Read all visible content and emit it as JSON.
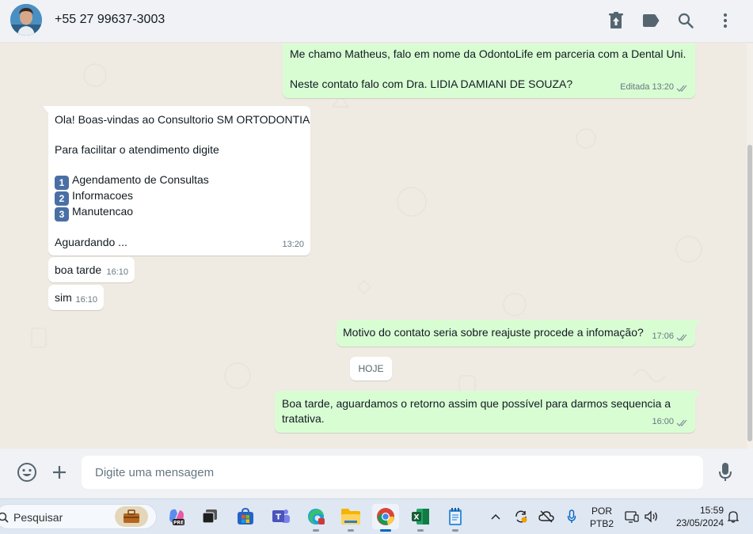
{
  "header": {
    "contact_name": "+55 27 99637-3003",
    "icons": [
      "sticker-pack-icon",
      "label-icon",
      "search-icon",
      "menu-icon"
    ]
  },
  "messages": [
    {
      "direction": "out",
      "lines": [
        "Me chamo Matheus, falo em nome da OdontoLife em parceria com a Dental Uni.",
        "",
        "Neste contato falo com Dra. LIDIA DAMIANI DE SOUZA?"
      ],
      "edited_label": "Editada",
      "time": "13:20",
      "status": "read"
    },
    {
      "direction": "in",
      "lines": [
        "Ola! Boas-vindas ao Consultorio SM ORTODONTIA",
        "",
        "Para facilitar o atendimento digite",
        ""
      ],
      "options": [
        {
          "number": "1",
          "label": "Agendamento de Consultas"
        },
        {
          "number": "2",
          "label": "Informacoes"
        },
        {
          "number": "3",
          "label": "Manutencao"
        }
      ],
      "footer": "Aguardando ...",
      "time": "13:20"
    },
    {
      "direction": "in",
      "text": "boa tarde",
      "time": "16:10"
    },
    {
      "direction": "in",
      "text": "sim",
      "time": "16:10"
    },
    {
      "direction": "out",
      "text": "Motivo do contato seria sobre reajuste procede a infomação?",
      "time": "17:06",
      "status": "read"
    },
    {
      "direction": "out",
      "lines": [
        "Boa tarde, aguardamos o retorno assim que possível para darmos sequencia a",
        "tratativa."
      ],
      "time": "16:00",
      "status": "read"
    }
  ],
  "day_separator": "HOJE",
  "composer": {
    "placeholder": "Digite uma mensagem",
    "icons": [
      "emoji-icon",
      "attach-plus-icon",
      "microphone-icon"
    ]
  },
  "taskbar": {
    "search_label": "Pesquisar",
    "apps": [
      "briefcase-app",
      "copilot-pre-app",
      "task-view-app",
      "store-app",
      "teams-app",
      "edge-app",
      "file-explorer-app",
      "chrome-app",
      "excel-app",
      "notepad-app"
    ],
    "active_app": "chrome-app",
    "lang_top": "POR",
    "lang_bottom": "PTB2",
    "time": "15:59",
    "date": "23/05/2024"
  },
  "colors": {
    "outgoing_bubble": "#d9fdd3",
    "incoming_bubble": "#ffffff",
    "chat_background": "#efeae2",
    "read_ticks": "#53bdeb"
  }
}
